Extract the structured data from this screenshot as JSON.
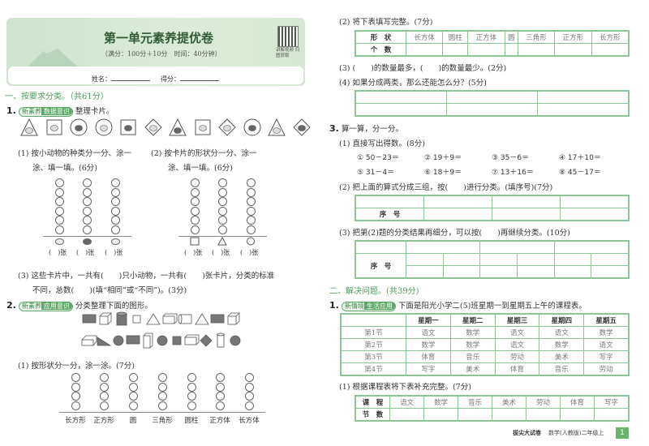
{
  "header": {
    "title": "第一单元素养提优卷",
    "subtitle": "（满分：100分＋10分　时间：40分钟）",
    "qr_caption": "讲解视频 扫图获取",
    "name_label": "姓名：",
    "score_label": "得分："
  },
  "left": {
    "section1": "一、按要求分类。（共61分）",
    "q1": {
      "num": "1.",
      "tag1": "新素养",
      "tag2": "数据意识",
      "text": "整理卡片。",
      "cards": [
        {
          "shape": "triangle",
          "animal": "cat"
        },
        {
          "shape": "square",
          "animal": "dog"
        },
        {
          "shape": "circle",
          "animal": "hedgehog"
        },
        {
          "shape": "circle",
          "animal": "dog"
        },
        {
          "shape": "square",
          "animal": "hedgehog"
        },
        {
          "shape": "diamond",
          "animal": "dog"
        },
        {
          "shape": "triangle",
          "animal": "hedgehog"
        },
        {
          "shape": "square",
          "animal": "cat"
        },
        {
          "shape": "diamond",
          "animal": "dog"
        },
        {
          "shape": "circle",
          "animal": "hedgehog"
        },
        {
          "shape": "triangle",
          "animal": "cat"
        },
        {
          "shape": "diamond",
          "animal": "hedgehog"
        }
      ],
      "p1a": "(1) 按小动物的种类分一分、涂一",
      "p1b": "涂、填一填。(6分)",
      "p2a": "(2) 按卡片的形状分一分、涂一",
      "p2b": "涂、填一填。(6分)",
      "blank_label": "(　)张",
      "p3a": "(3) 这些卡片中，一共有(　　)只小动物，一共有(　　)张卡片，分类的标准",
      "p3b": "不同，总数(　　)(填“相同”或“不同”)。(3分)"
    },
    "q2": {
      "num": "2.",
      "tag1": "新素养",
      "tag2": "应用意识",
      "text": "分类整理下面的图形。",
      "row1": [
        "rect-filled",
        "cube",
        "cylinder-filled",
        "square",
        "triangle",
        "cuboid",
        "cylinder-lying",
        "triangle",
        "rect-filled",
        "cube"
      ],
      "row2": [
        "cuboid-flat",
        "right-triangle-filled",
        "circle-filled",
        "rect-filled",
        "cuboid-tall",
        "circle-filled",
        "square-filled",
        "cuboid",
        "diamond-filled",
        "cylinder",
        "circle-filled"
      ],
      "p1": "(1) 按形状分一分，涂一涂。(7分)",
      "labels": [
        "长方形",
        "正方形",
        "圆",
        "三角形",
        "圆柱",
        "正方体",
        "长方体"
      ]
    }
  },
  "right": {
    "p2": "(2) 将下表填写完整。(7分)",
    "shape_table": {
      "row_head": "形　状",
      "count_head": "个　数",
      "cols": [
        "长方体",
        "圆柱",
        "正方体",
        "圆",
        "三角形",
        "正方形",
        "长方形"
      ]
    },
    "p3": "(3) (　　)的数量最多，(　　)的数量最少。(2分)",
    "p4": "(4) 如果分成两类，那么还能怎么分？(5分)",
    "q3": {
      "num": "3.",
      "text": "算一算，分一分。",
      "p1": "(1) 直接写出得数。(8分)",
      "eqs": [
        "① 50－23＝",
        "② 19＋9＝",
        "③ 35－6＝",
        "④ 17＋10＝",
        "⑤ 31－4＝",
        "⑥ 18＋9＝",
        "⑦ 13＋16＝",
        "⑧ 45－17＝"
      ],
      "p2": "(2) 把上面的算式分成三组，按(　　)进行分类。(填序号)(7分)",
      "seq": "序　号",
      "p3": "(3) 把第(2)题的分类结果再细分，可以按(　　)再继续分类。(10分)"
    },
    "section2": "二、解决问题。(共39分)",
    "s2q1": {
      "num": "1.",
      "tag1": "新情境",
      "tag2": "生活应用",
      "text": "下面是阳光小学二(5)班星期一到星期五上午的课程表。",
      "days": [
        "星期一",
        "星期二",
        "星期三",
        "星期四",
        "星期五"
      ],
      "rows": [
        {
          "period": "第1节",
          "c": [
            "语文",
            "数学",
            "语文",
            "语文",
            "数学"
          ]
        },
        {
          "period": "第2节",
          "c": [
            "数学",
            "数学",
            "语文",
            "数学",
            "语文"
          ]
        },
        {
          "period": "第3节",
          "c": [
            "体育",
            "音乐",
            "劳动",
            "美术",
            "写字"
          ]
        },
        {
          "period": "第4节",
          "c": [
            "写字",
            "美术",
            "体育",
            "音乐",
            "劳动"
          ]
        }
      ],
      "p1": "(1) 根据课程表将下表补充完整。(7分)",
      "course_head": "课　程",
      "count_head": "节　数",
      "courses": [
        "语文",
        "数学",
        "音乐",
        "美术",
        "劳动",
        "体育",
        "写字"
      ]
    },
    "footer": {
      "brand": "拔尖大试卷",
      "subject": "数学(人教版)二年级上",
      "page": "1"
    }
  }
}
